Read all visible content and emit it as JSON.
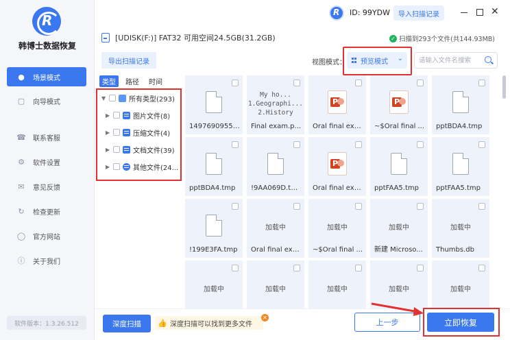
{
  "app": {
    "brand": "韩博士数据恢复",
    "version": "软件版本：1.3.26.512"
  },
  "sidebar": {
    "items": [
      {
        "label": "场景模式",
        "icon": "scene-icon"
      },
      {
        "label": "向导模式",
        "icon": "wizard-icon"
      }
    ],
    "secondary": [
      {
        "label": "联系客服",
        "icon": "headset-icon"
      },
      {
        "label": "软件设置",
        "icon": "gear-icon"
      },
      {
        "label": "意见反馈",
        "icon": "feedback-icon"
      },
      {
        "label": "检查更新",
        "icon": "update-icon"
      },
      {
        "label": "官方网站",
        "icon": "globe-icon"
      },
      {
        "label": "关于我们",
        "icon": "info-icon"
      }
    ]
  },
  "header": {
    "user_id": "ID: 99YDW",
    "import_label": "导入扫描记录"
  },
  "drive": {
    "info": "[UDISK(F:)] FAT32 可用空间24.5GB(31.2GB)",
    "scanned": "扫描到293个文件(共144.93MB)"
  },
  "toolbar": {
    "export_label": "导出扫描记录",
    "view_label": "视图模式：",
    "view_value": "预览模式",
    "search_placeholder": "请输入文件名搜索"
  },
  "tree": {
    "tabs": [
      "类型",
      "路径",
      "时间"
    ],
    "root": "所有类型(293)",
    "children": [
      "图片文件(8)",
      "压缩文件(4)",
      "文档文件(39)",
      "其他文件(24..."
    ]
  },
  "files": [
    {
      "name": "14976909556...",
      "kind": "doc"
    },
    {
      "name": "Final exam.p...",
      "kind": "preview",
      "preview": [
        "My ho...",
        "1.Geographi...",
        "2.History"
      ]
    },
    {
      "name": "Oral final exa...",
      "kind": "ppt"
    },
    {
      "name": "~$Oral final ...",
      "kind": "ppt"
    },
    {
      "name": "pptBDA4.tmp",
      "kind": "doc"
    },
    {
      "name": "pptBDA4.tmp",
      "kind": "doc"
    },
    {
      "name": "!9AA069D.tmp",
      "kind": "doc"
    },
    {
      "name": "Oral final exa...",
      "kind": "ppt"
    },
    {
      "name": "pptFAA5.tmp",
      "kind": "doc"
    },
    {
      "name": "pptFAA5.tmp",
      "kind": "doc"
    },
    {
      "name": "!199E3FA.tmp",
      "kind": "doc"
    },
    {
      "name": "Oral final exa...",
      "kind": "loading"
    },
    {
      "name": "~$Oral final ...",
      "kind": "loading"
    },
    {
      "name": "新建 Microso...",
      "kind": "loading"
    },
    {
      "name": "Thumbs.db",
      "kind": "loading"
    },
    {
      "name": "",
      "kind": "loading"
    },
    {
      "name": "",
      "kind": "loading"
    },
    {
      "name": "",
      "kind": "loading"
    },
    {
      "name": "",
      "kind": "loading"
    },
    {
      "name": "",
      "kind": "loading"
    }
  ],
  "loading_text": "加载中",
  "footer": {
    "deep_scan": "深度扫描",
    "tip": "深度扫描可以找到更多文件",
    "prev": "上一步",
    "recover": "立即恢复"
  }
}
